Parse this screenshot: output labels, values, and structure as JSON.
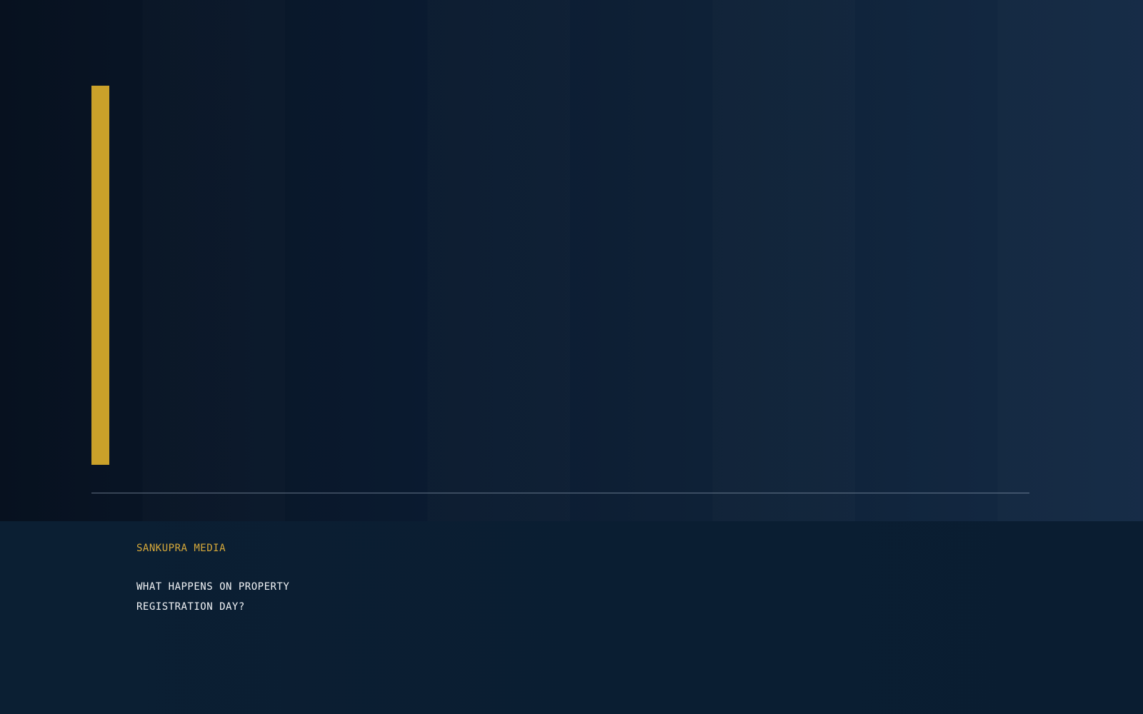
{
  "brand": {
    "name": "SANKUPRA MEDIA"
  },
  "headline": {
    "line1": "WHAT HAPPENS ON PROPERTY",
    "line2": "REGISTRATION DAY?"
  },
  "colors": {
    "accent": "#caa12a",
    "brand_text": "#d7a93a",
    "headline_text": "#f2f4f7",
    "background_dark": "#07111f",
    "background_light": "#142a45",
    "footer_background": "#0b1f33"
  }
}
